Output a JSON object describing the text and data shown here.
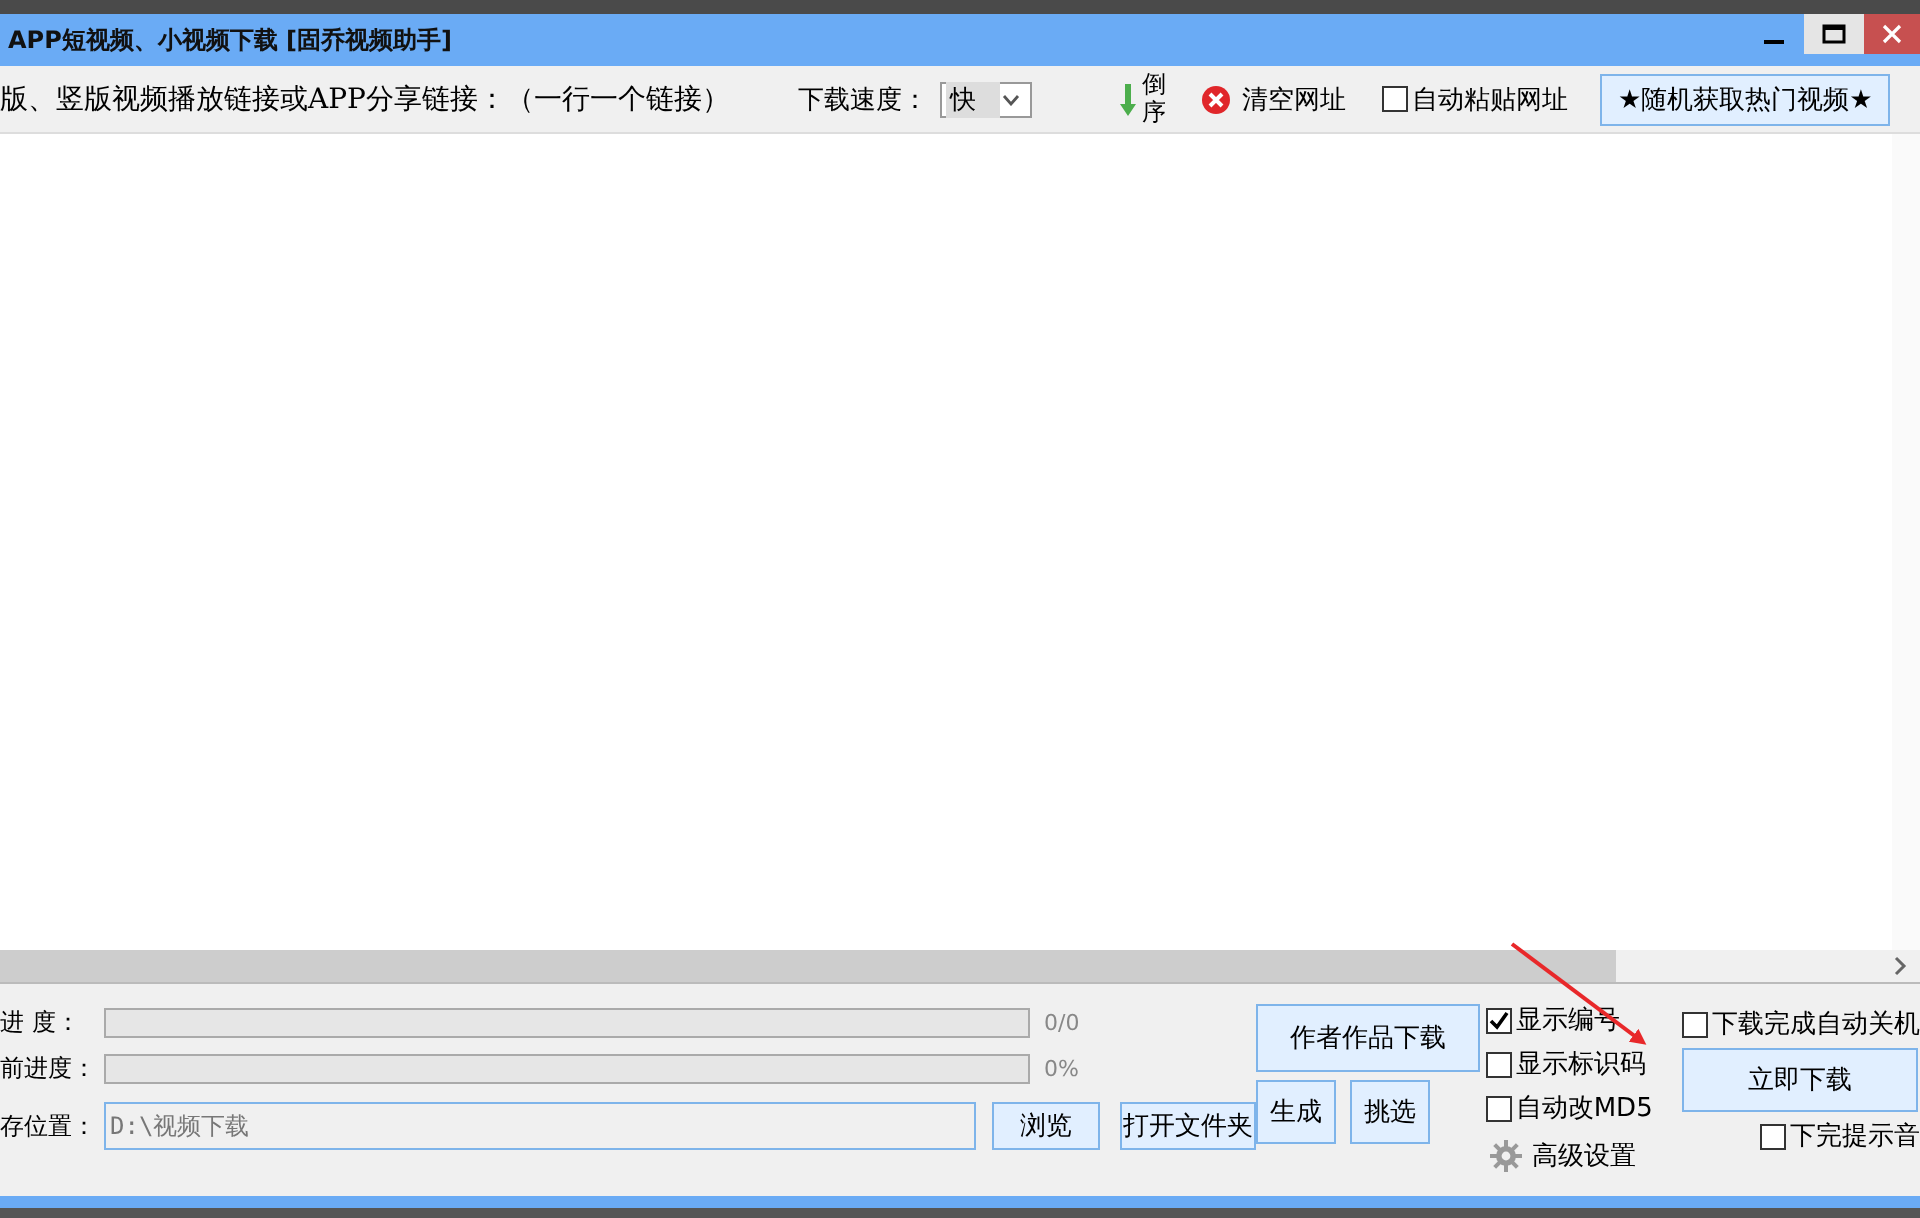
{
  "window": {
    "title": "APP短视频、小视频下载 [固乔视频助手]"
  },
  "toolbar": {
    "prompt": "版、竖版视频播放链接或APP分享链接：（一行一个链接）",
    "speed_label": "下载速度：",
    "speed": {
      "value": "快"
    },
    "reverse_label": "倒序",
    "clear_label": "清空网址",
    "auto_paste": {
      "label": "自动粘贴网址",
      "checked": false
    },
    "random_button": "★随机获取热门视频★"
  },
  "progress": [
    {
      "label": "进 度：",
      "level": 0,
      "reading": "0/0"
    },
    {
      "label": "前进度：",
      "level": 0,
      "reading": "0%"
    }
  ],
  "save": {
    "label": "存位置：",
    "value": "D:\\视频下载",
    "browse": "浏览",
    "open_folder": "打开文件夹"
  },
  "buttons": {
    "author": "作者作品下载",
    "generate": "生成",
    "filter": "挑选",
    "download": "立即下载"
  },
  "options": [
    {
      "label": "显示编号",
      "checked": true
    },
    {
      "label": "显示标识码",
      "checked": false
    },
    {
      "label": "自动改MD5",
      "checked": false
    }
  ],
  "advanced": "高级设置",
  "shutdown": {
    "label": "下载完成自动关机",
    "checked": false
  },
  "sound": {
    "label": "下完提示音",
    "checked": false
  }
}
